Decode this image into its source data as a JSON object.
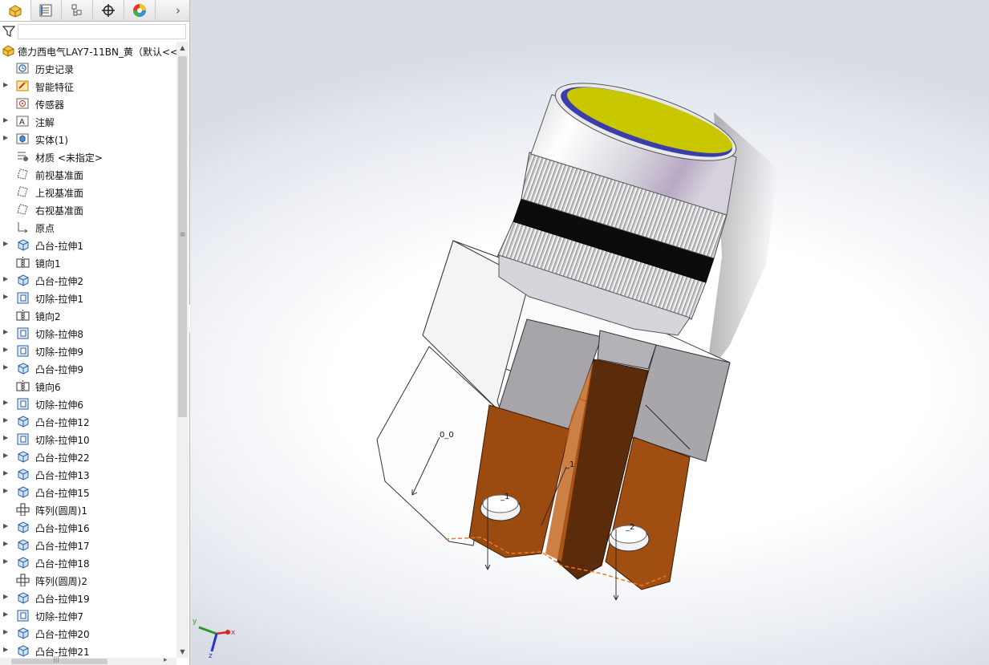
{
  "panel_tabs": [
    {
      "name": "featuremanager-tab",
      "icon": "featuremanager-icon"
    },
    {
      "name": "propertymanager-tab",
      "icon": "propertymanager-icon"
    },
    {
      "name": "configurationmanager-tab",
      "icon": "configurationmanager-icon"
    },
    {
      "name": "dimxpert-tab",
      "icon": "dimxpert-icon"
    },
    {
      "name": "display-manager-tab",
      "icon": "display-manager-icon"
    }
  ],
  "tree": {
    "root_label": "德力西电气LAY7-11BN_黄（默认<<",
    "items": [
      {
        "label": "历史记录",
        "icon": "history-icon",
        "expandable": false
      },
      {
        "label": "智能特征",
        "icon": "smart-feature-icon",
        "expandable": true
      },
      {
        "label": "传感器",
        "icon": "sensor-icon",
        "expandable": false
      },
      {
        "label": "注解",
        "icon": "annotation-icon",
        "expandable": true
      },
      {
        "label": "实体(1)",
        "icon": "solid-body-icon",
        "expandable": true
      },
      {
        "label": "材质 <未指定>",
        "icon": "material-icon",
        "expandable": false
      },
      {
        "label": "前视基准面",
        "icon": "plane-icon",
        "expandable": false
      },
      {
        "label": "上视基准面",
        "icon": "plane-icon",
        "expandable": false
      },
      {
        "label": "右视基准面",
        "icon": "plane-icon",
        "expandable": false
      },
      {
        "label": "原点",
        "icon": "origin-icon",
        "expandable": false
      },
      {
        "label": "凸台-拉伸1",
        "icon": "boss-extrude-icon",
        "expandable": true
      },
      {
        "label": "镜向1",
        "icon": "mirror-icon",
        "expandable": false
      },
      {
        "label": "凸台-拉伸2",
        "icon": "boss-extrude-icon",
        "expandable": true
      },
      {
        "label": "切除-拉伸1",
        "icon": "cut-extrude-icon",
        "expandable": true
      },
      {
        "label": "镜向2",
        "icon": "mirror-icon",
        "expandable": false
      },
      {
        "label": "切除-拉伸8",
        "icon": "cut-extrude-icon",
        "expandable": true
      },
      {
        "label": "切除-拉伸9",
        "icon": "cut-extrude-icon",
        "expandable": true
      },
      {
        "label": "凸台-拉伸9",
        "icon": "boss-extrude-icon",
        "expandable": true
      },
      {
        "label": "镜向6",
        "icon": "mirror-icon",
        "expandable": false
      },
      {
        "label": "切除-拉伸6",
        "icon": "cut-extrude-icon",
        "expandable": true
      },
      {
        "label": "凸台-拉伸12",
        "icon": "boss-extrude-icon",
        "expandable": true
      },
      {
        "label": "切除-拉伸10",
        "icon": "cut-extrude-icon",
        "expandable": true
      },
      {
        "label": "凸台-拉伸22",
        "icon": "boss-extrude-icon",
        "expandable": true
      },
      {
        "label": "凸台-拉伸13",
        "icon": "boss-extrude-icon",
        "expandable": true
      },
      {
        "label": "凸台-拉伸15",
        "icon": "boss-extrude-icon",
        "expandable": true
      },
      {
        "label": "阵列(圆周)1",
        "icon": "circular-pattern-icon",
        "expandable": false
      },
      {
        "label": "凸台-拉伸16",
        "icon": "boss-extrude-icon",
        "expandable": true
      },
      {
        "label": "凸台-拉伸17",
        "icon": "boss-extrude-icon",
        "expandable": true
      },
      {
        "label": "凸台-拉伸18",
        "icon": "boss-extrude-icon",
        "expandable": true
      },
      {
        "label": "阵列(圆周)2",
        "icon": "circular-pattern-icon",
        "expandable": false
      },
      {
        "label": "凸台-拉伸19",
        "icon": "boss-extrude-icon",
        "expandable": true
      },
      {
        "label": "切除-拉伸7",
        "icon": "cut-extrude-icon",
        "expandable": true
      },
      {
        "label": "凸台-拉伸20",
        "icon": "boss-extrude-icon",
        "expandable": true
      },
      {
        "label": "凸台-拉伸21",
        "icon": "boss-extrude-icon",
        "expandable": true
      }
    ]
  },
  "viewport": {
    "sketch_labels": [
      "0_0",
      "_1",
      "_1",
      "_2"
    ],
    "triad": {
      "x": "x",
      "y": "y",
      "z": "z"
    }
  },
  "colors": {
    "button_yellow": "#c9c700",
    "copper": "#9b4a10",
    "housing_grey": "#a8a6ab",
    "background_edge": "#d7dce5"
  }
}
